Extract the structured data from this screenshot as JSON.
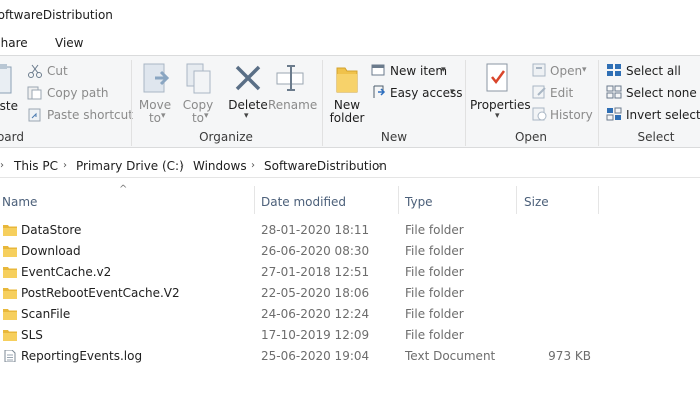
{
  "window": {
    "title": "SoftwareDistribution"
  },
  "tabs": [
    {
      "label": "Share"
    },
    {
      "label": "View"
    }
  ],
  "ribbon": {
    "clipboard": {
      "label": "Clipboard",
      "paste": "Paste",
      "cut": "Cut",
      "copy_path": "Copy path",
      "paste_shortcut": "Paste shortcut"
    },
    "organize": {
      "label": "Organize",
      "move_to_1": "Move",
      "move_to_2": "to",
      "copy_to_1": "Copy",
      "copy_to_2": "to",
      "delete": "Delete",
      "rename": "Rename"
    },
    "new": {
      "label": "New",
      "new_folder_1": "New",
      "new_folder_2": "folder",
      "new_item": "New item",
      "easy_access": "Easy access"
    },
    "open": {
      "label": "Open",
      "properties": "Properties",
      "open": "Open",
      "edit": "Edit",
      "history": "History"
    },
    "select": {
      "label": "Select",
      "select_all": "Select all",
      "select_none": "Select none",
      "invert": "Invert selection"
    }
  },
  "breadcrumb": [
    "This PC",
    "Primary Drive (C:)",
    "Windows",
    "SoftwareDistribution"
  ],
  "columns": {
    "name": "Name",
    "date": "Date modified",
    "type": "Type",
    "size": "Size"
  },
  "files": [
    {
      "name": "DataStore",
      "date": "28-01-2020 18:11",
      "type": "File folder",
      "size": "",
      "kind": "folder"
    },
    {
      "name": "Download",
      "date": "26-06-2020 08:30",
      "type": "File folder",
      "size": "",
      "kind": "folder"
    },
    {
      "name": "EventCache.v2",
      "date": "27-01-2018 12:51",
      "type": "File folder",
      "size": "",
      "kind": "folder"
    },
    {
      "name": "PostRebootEventCache.V2",
      "date": "22-05-2020 18:06",
      "type": "File folder",
      "size": "",
      "kind": "folder"
    },
    {
      "name": "ScanFile",
      "date": "24-06-2020 12:24",
      "type": "File folder",
      "size": "",
      "kind": "folder"
    },
    {
      "name": "SLS",
      "date": "17-10-2019 12:09",
      "type": "File folder",
      "size": "",
      "kind": "folder"
    },
    {
      "name": "ReportingEvents.log",
      "date": "25-06-2020 19:04",
      "type": "Text Document",
      "size": "973 KB",
      "kind": "document"
    }
  ],
  "colors": {
    "folder": "#e8b73a",
    "accent": "#0a64ad",
    "header_text": "#4c607a"
  }
}
